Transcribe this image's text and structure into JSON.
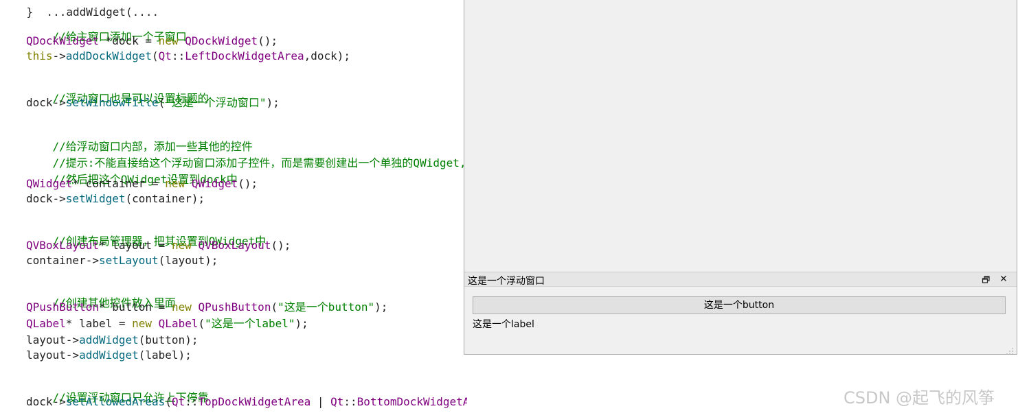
{
  "code": {
    "truncated_top": "}  ...addWidget(....",
    "lines": {
      "c1": "//给主窗口添加一个子窗口",
      "l1_type": "QDockWidget",
      "l1_mid": " *dock = ",
      "l1_new": "new",
      "l1_sp": " ",
      "l1_ctor": "QDockWidget",
      "l1_end": "();",
      "l2_this": "this",
      "l2_arrow": "->",
      "l2_fn": "addDockWidget",
      "l2_open": "(",
      "l2_ns": "Qt",
      "l2_sep": "::",
      "l2_enum": "LeftDockWidgetArea",
      "l2_end": ",dock);",
      "c2": "//浮动窗口也是可以设置标题的",
      "l3_obj": "dock->",
      "l3_fn": "setWindowTitle",
      "l3_open": "(",
      "l3_str": "\"这是一个浮动窗口\"",
      "l3_end": ");",
      "c3": "//给浮动窗口内部，添加一些其他的控件",
      "c4": "//提示:不能直接给这个浮动窗口添加子控件，而是需要创建出一个单独的QWidget,",
      "c5": "//然后把这个QWidget设置到dock中",
      "l4_type": "QWidget",
      "l4_mid": "* container = ",
      "l4_new": "new",
      "l4_sp": " ",
      "l4_ctor": "QWidget",
      "l4_end": "();",
      "l5_obj": "dock->",
      "l5_fn": "setWidget",
      "l5_end": "(container);",
      "c6": "//创建布局管理器，把其设置到QWidget中",
      "l6_type": "QVBoxLayout",
      "l6_mid": "* layout = ",
      "l6_new": "new",
      "l6_sp": " ",
      "l6_ctor": "QVBoxLayout",
      "l6_end": "();",
      "l7_obj": "container->",
      "l7_fn": "setLayout",
      "l7_end": "(layout);",
      "c7": "//创建其他控件放入里面",
      "l8_type": "QPushButton",
      "l8_mid": "* button = ",
      "l8_new": "new",
      "l8_sp": " ",
      "l8_ctor": "QPushButton",
      "l8_open": "(",
      "l8_str": "\"这是一个button\"",
      "l8_end": ");",
      "l9_type": "QLabel",
      "l9_mid": "* label = ",
      "l9_new": "new",
      "l9_sp": " ",
      "l9_ctor": "QLabel",
      "l9_open": "(",
      "l9_str": "\"这是一个label\"",
      "l9_end": ");",
      "l10_obj": "layout->",
      "l10_fn": "addWidget",
      "l10_end": "(button);",
      "l11_obj": "layout->",
      "l11_fn": "addWidget",
      "l11_end": "(label);",
      "c8": "//设置浮动窗口只允许上下停靠",
      "l12_obj": "dock->",
      "l12_fn": "setAllowedAreas",
      "l12_open": "(",
      "l12_ns1": "Qt",
      "l12_sep1": "::",
      "l12_enum1": "TopDockWidgetArea",
      "l12_pipe": " | ",
      "l12_ns2": "Qt",
      "l12_sep2": "::",
      "l12_enum2": "BottomDockWidgetArea",
      "l12_end": ");"
    }
  },
  "dock": {
    "title": "这是一个浮动窗口",
    "float_icon": "restore-icon",
    "close_icon": "close-icon",
    "close_glyph": "✕",
    "button_label": "这是一个button",
    "label_text": "这是一个label"
  },
  "watermark": "CSDN @起飞的风筝",
  "colors": {
    "comment": "#008000",
    "type": "#800080",
    "keyword": "#808000",
    "function": "#00677c",
    "window_bg": "#f0f0f0"
  }
}
